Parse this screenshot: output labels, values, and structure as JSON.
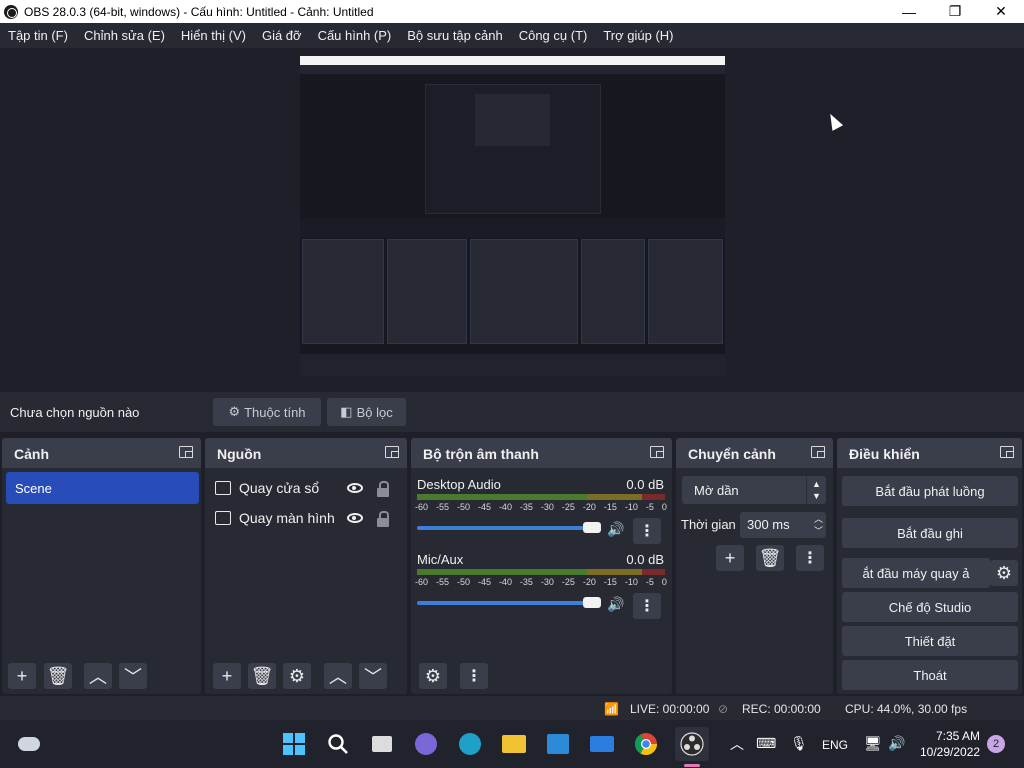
{
  "window": {
    "title": "OBS 28.0.3 (64-bit, windows) - Cấu hình: Untitled - Cảnh: Untitled",
    "minimize": "—",
    "maximize": "❐",
    "close": "✕"
  },
  "menu": [
    "Tập tin (F)",
    "Chỉnh sửa (E)",
    "Hiển thị (V)",
    "Giá đỡ",
    "Cấu hình (P)",
    "Bộ sưu tập cảnh",
    "Công cụ (T)",
    "Trợ giúp (H)"
  ],
  "source_toolbar": {
    "no_source": "Chưa chọn nguồn nào",
    "properties": "Thuộc tính",
    "filters": "Bộ lọc"
  },
  "scenes": {
    "title": "Cảnh",
    "items": [
      "Scene"
    ]
  },
  "sources": {
    "title": "Nguồn",
    "items": [
      "Quay cửa sổ",
      "Quay màn hình"
    ]
  },
  "mixer": {
    "title": "Bộ trộn âm thanh",
    "ticks": [
      "-60",
      "-55",
      "-50",
      "-45",
      "-40",
      "-35",
      "-30",
      "-25",
      "-20",
      "-15",
      "-10",
      "-5",
      "0"
    ],
    "channels": [
      {
        "name": "Desktop Audio",
        "db": "0.0 dB",
        "volume": 1.0
      },
      {
        "name": "Mic/Aux",
        "db": "0.0 dB",
        "volume": 1.0
      }
    ]
  },
  "transitions": {
    "title": "Chuyển cảnh",
    "selected": "Mờ dần",
    "duration_label": "Thời gian",
    "duration_value": "300 ms"
  },
  "controls": {
    "title": "Điều khiển",
    "start_streaming": "Bắt đầu phát luồng",
    "start_recording": "Bắt đầu ghi",
    "start_virtual_cam": "ắt đầu máy quay ả",
    "studio_mode": "Chế độ Studio",
    "settings": "Thiết đặt",
    "exit": "Thoát"
  },
  "status": {
    "live": "LIVE: 00:00:00",
    "rec": "REC: 00:00:00",
    "cpu": "CPU: 44.0%, 30.00 fps"
  },
  "taskbar": {
    "lang": "ENG",
    "time": "7:35 AM",
    "date": "10/29/2022",
    "notifications": "2"
  },
  "colors": {
    "accent": "#284cb8",
    "panel": "#272a33",
    "header": "#3a3d4a",
    "background": "#1e1f29"
  }
}
